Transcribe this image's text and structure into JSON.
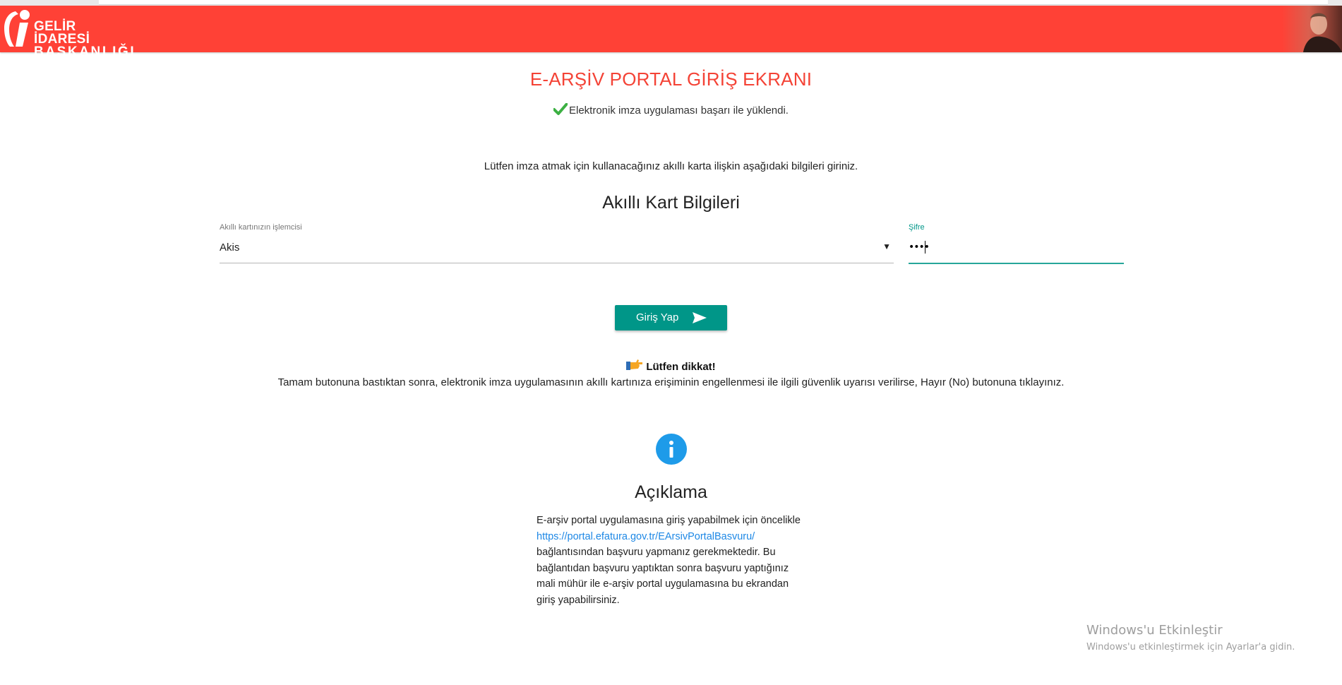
{
  "header": {
    "logo_line1": "GELİR İDARESİ",
    "logo_line2": "BAŞKANLIĞI",
    "brand_color": "#ff4136"
  },
  "page": {
    "title": "E-ARŞİV PORTAL GİRİŞ EKRANI",
    "loaded_message": "Elektronik imza uygulaması başarı ile yüklendi.",
    "instruction": "Lütfen imza atmak için kullanacağınız akıllı karta ilişkin aşağıdaki bilgileri giriniz.",
    "section_title": "Akıllı Kart Bilgileri"
  },
  "form": {
    "processor_label": "Akıllı kartınızın işlemcisi",
    "processor_value": "Akis",
    "password_label": "Şifre",
    "password_value": "••••",
    "login_label": "Giriş Yap"
  },
  "notice": {
    "title": "Lütfen dikkat!",
    "text": "Tamam butonuna bastıktan sonra, elektronik imza uygulamasının akıllı kartınıza erişiminin engellenmesi ile ilgili güvenlik uyarısı verilirse, Hayır (No) butonuna tıklayınız."
  },
  "description": {
    "title": "Açıklama",
    "text_before": "E-arşiv portal uygulamasına giriş yapabilmek için öncelikle",
    "link": "https://portal.efatura.gov.tr/EArsivPortalBasvuru/",
    "text_after": "bağlantısından başvuru yapmanız gerekmektedir. Bu bağlantıdan başvuru yaptıktan sonra başvuru yaptığınız mali mühür ile e-arşiv portal uygulamasına bu ekrandan giriş yapabilirsiniz."
  },
  "watermark": {
    "line1": "Windows'u Etkinleştir",
    "line2": "Windows'u etkinleştirmek için Ayarlar'a gidin."
  },
  "icons": {
    "check": "check-icon",
    "send": "send-icon",
    "hand": "pointing-hand-icon",
    "info": "info-icon"
  },
  "colors": {
    "title": "#f44336",
    "accent": "#009688",
    "link": "#1e88e5",
    "info": "#1e9be9",
    "check": "#3cb043"
  }
}
